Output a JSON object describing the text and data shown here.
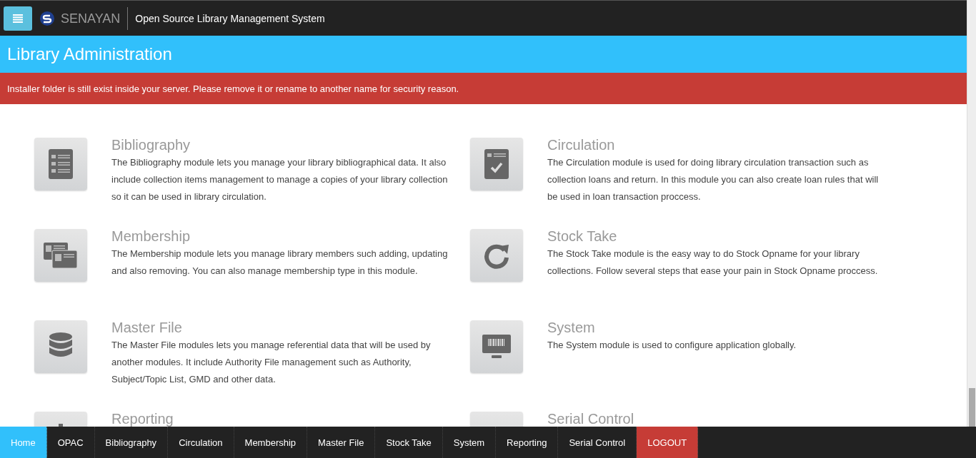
{
  "topbar": {
    "brand": "SENAYAN",
    "subtitle": "Open Source Library Management System"
  },
  "header": {
    "title": "Library Administration"
  },
  "alert": {
    "text": "Installer folder is still exist inside your server. Please remove it or rename to another name for security reason."
  },
  "modules": [
    {
      "kind": "bibliography",
      "title": "Bibliography",
      "description": "The Bibliography module lets you manage your library bibliographical data. It also include collection items management to manage a copies of your library collection so it can be used in library circulation."
    },
    {
      "kind": "circulation",
      "title": "Circulation",
      "description": "The Circulation module is used for doing library circulation transaction such as collection loans and return. In this module you can also create loan rules that will be used in loan transaction proccess."
    },
    {
      "kind": "membership",
      "title": "Membership",
      "description": "The Membership module lets you manage library members such adding, updating and also removing. You can also manage membership type in this module."
    },
    {
      "kind": "stocktake",
      "title": "Stock Take",
      "description": "The Stock Take module is the easy way to do Stock Opname for your library collections. Follow several steps that ease your pain in Stock Opname proccess."
    },
    {
      "kind": "masterfile",
      "title": "Master File",
      "description": "The Master File modules lets you manage referential data that will be used by another modules. It include Authority File management such as Authority, Subject/Topic List, GMD and other data."
    },
    {
      "kind": "system",
      "title": "System",
      "description": "The System module is used to configure application globally."
    },
    {
      "kind": "reporting",
      "title": "Reporting"
    },
    {
      "kind": "serial",
      "title": "Serial Control"
    }
  ],
  "nav": [
    {
      "label": "Home",
      "kind": "link",
      "selected": true
    },
    {
      "label": "OPAC",
      "kind": "link",
      "selected": false
    },
    {
      "label": "Bibliography",
      "kind": "link",
      "selected": false
    },
    {
      "label": "Circulation",
      "kind": "link",
      "selected": false
    },
    {
      "label": "Membership",
      "kind": "link",
      "selected": false
    },
    {
      "label": "Master File",
      "kind": "link",
      "selected": false
    },
    {
      "label": "Stock Take",
      "kind": "link",
      "selected": false
    },
    {
      "label": "System",
      "kind": "link",
      "selected": false
    },
    {
      "label": "Reporting",
      "kind": "link",
      "selected": false
    },
    {
      "label": "Serial Control",
      "kind": "link",
      "selected": false
    },
    {
      "label": "LOGOUT",
      "kind": "logout",
      "selected": false
    }
  ]
}
